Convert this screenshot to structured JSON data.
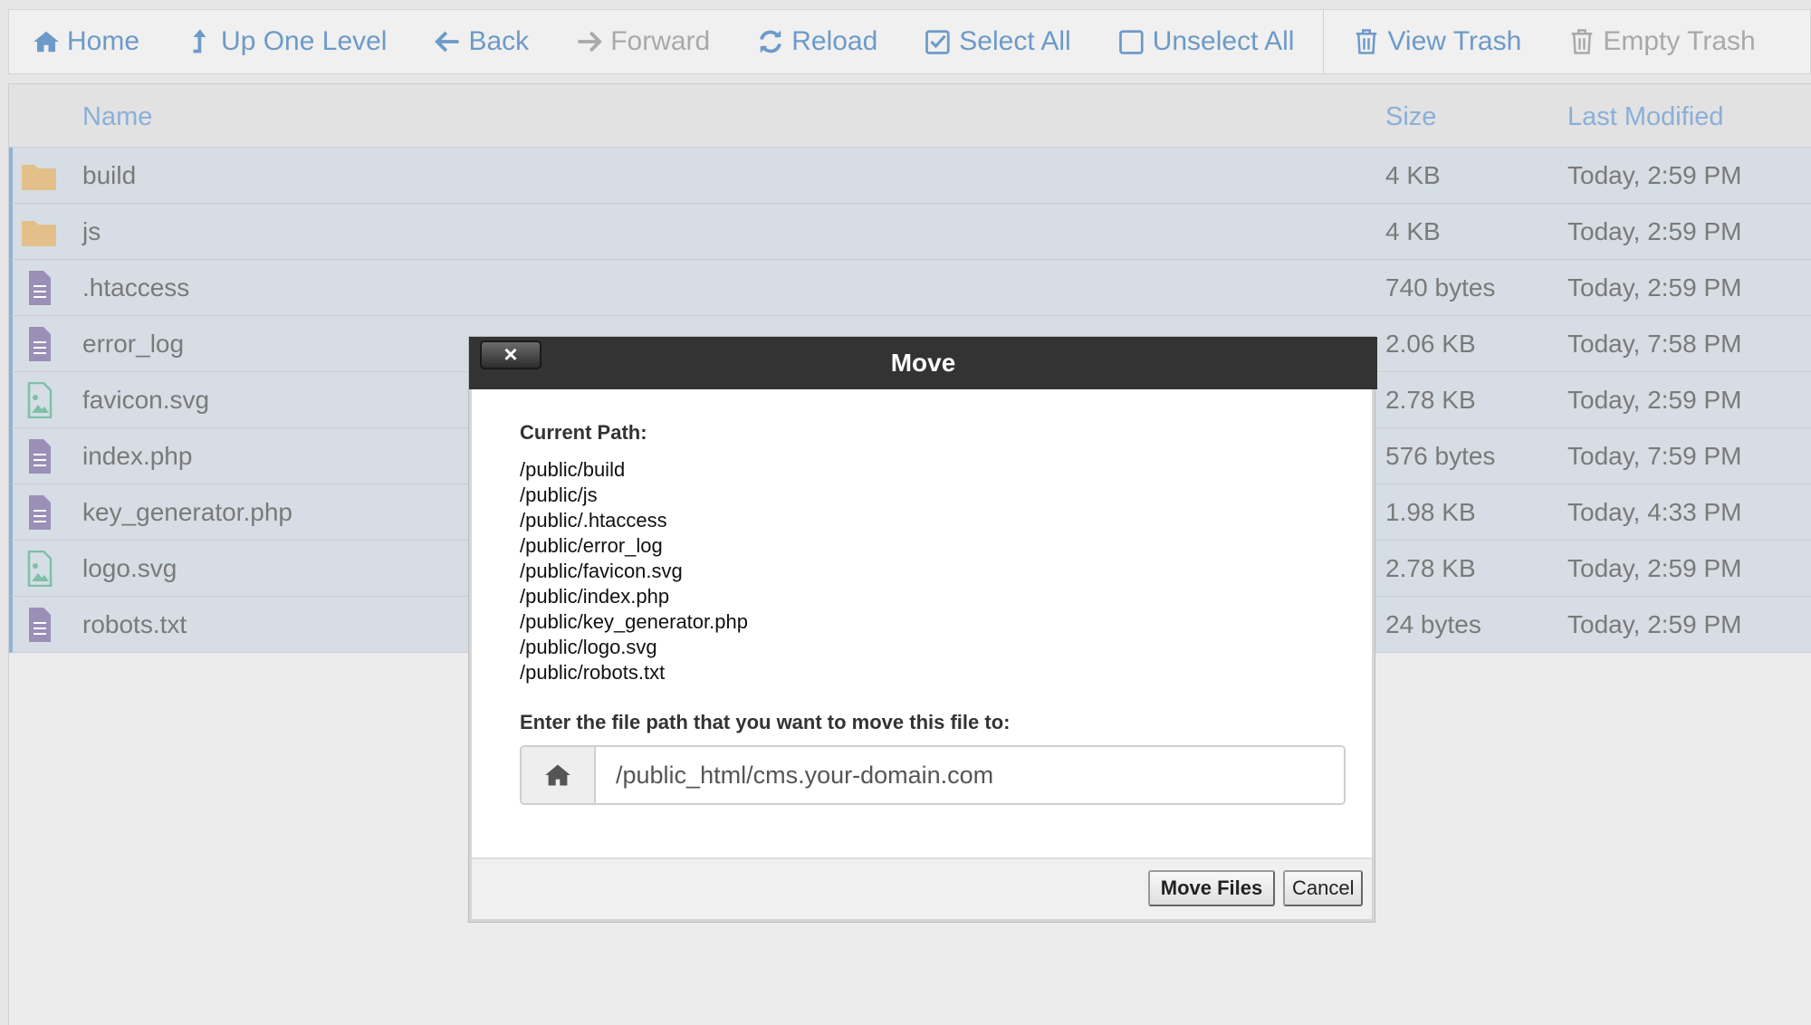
{
  "toolbar": {
    "home": "Home",
    "up_one_level": "Up One Level",
    "back": "Back",
    "forward": "Forward",
    "reload": "Reload",
    "select_all": "Select All",
    "unselect_all": "Unselect All",
    "view_trash": "View Trash",
    "empty_trash": "Empty Trash"
  },
  "columns": {
    "name": "Name",
    "size": "Size",
    "last_modified": "Last Modified"
  },
  "files": [
    {
      "name": "build",
      "size": "4 KB",
      "modified": "Today, 2:59 PM",
      "icon": "folder-icon"
    },
    {
      "name": "js",
      "size": "4 KB",
      "modified": "Today, 2:59 PM",
      "icon": "folder-icon"
    },
    {
      "name": ".htaccess",
      "size": "740 bytes",
      "modified": "Today, 2:59 PM",
      "icon": "text-file-icon"
    },
    {
      "name": "error_log",
      "size": "2.06 KB",
      "modified": "Today, 7:58 PM",
      "icon": "text-file-icon"
    },
    {
      "name": "favicon.svg",
      "size": "2.78 KB",
      "modified": "Today, 2:59 PM",
      "icon": "image-file-icon"
    },
    {
      "name": "index.php",
      "size": "576 bytes",
      "modified": "Today, 7:59 PM",
      "icon": "text-file-icon"
    },
    {
      "name": "key_generator.php",
      "size": "1.98 KB",
      "modified": "Today, 4:33 PM",
      "icon": "text-file-icon"
    },
    {
      "name": "logo.svg",
      "size": "2.78 KB",
      "modified": "Today, 2:59 PM",
      "icon": "image-file-icon"
    },
    {
      "name": "robots.txt",
      "size": "24 bytes",
      "modified": "Today, 2:59 PM",
      "icon": "text-file-icon"
    }
  ],
  "modal": {
    "title": "Move",
    "close_label": "×",
    "current_path_label": "Current Path:",
    "paths": [
      "/public/build",
      "/public/js",
      "/public/.htaccess",
      "/public/error_log",
      "/public/favicon.svg",
      "/public/index.php",
      "/public/key_generator.php",
      "/public/logo.svg",
      "/public/robots.txt"
    ],
    "dest_label": "Enter the file path that you want to move this file to:",
    "dest_value": "/public_html/cms.your-domain.com",
    "move_button": "Move Files",
    "cancel_button": "Cancel"
  },
  "colors": {
    "accent": "#6d9ac8",
    "selected_row": "#d6dde4",
    "folder": "#e3c08a",
    "text_file": "#9b8fb8",
    "image_file": "#7fbfa8",
    "titlebar": "#333333"
  }
}
